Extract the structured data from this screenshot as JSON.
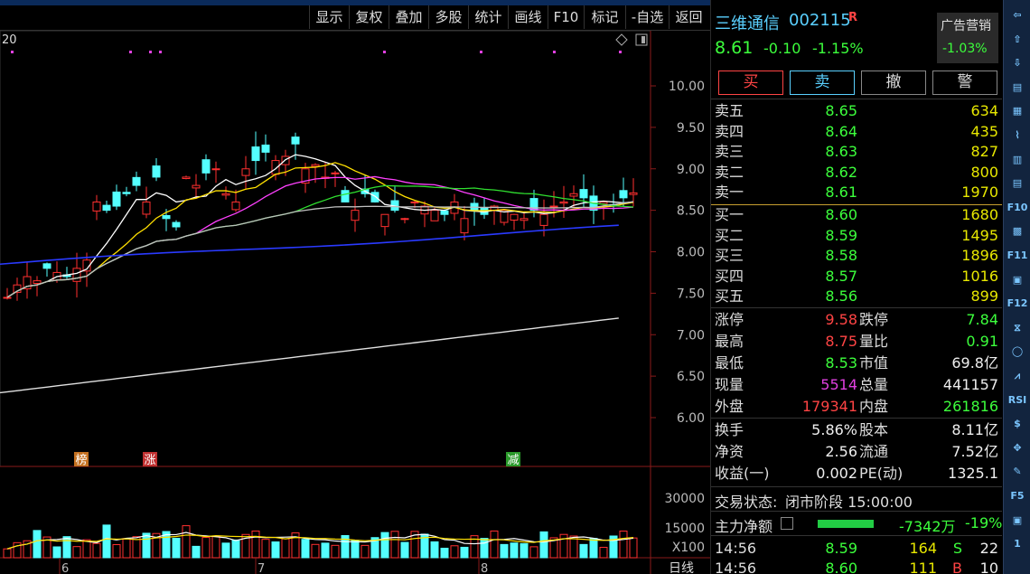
{
  "toolbar": {
    "items": [
      "显示",
      "复权",
      "叠加",
      "多股",
      "统计",
      "画线",
      "F10",
      "标记",
      "-自选",
      "返回"
    ]
  },
  "chart": {
    "corner_label": "20",
    "price_axis": [
      "10.00",
      "9.50",
      "9.00",
      "8.50",
      "8.00",
      "7.50",
      "7.00",
      "6.50",
      "6.00"
    ],
    "volume_axis": [
      "30000",
      "15000",
      "X100"
    ],
    "date_labels": [
      "6",
      "7",
      "8"
    ],
    "period_label": "日线",
    "badges": [
      {
        "text": "榜",
        "color": "#c47020"
      },
      {
        "text": "涨",
        "color": "#c03030"
      },
      {
        "text": "减",
        "color": "#2a9a2a"
      }
    ]
  },
  "quote": {
    "name": "三维通信",
    "code": "002115",
    "tag": "R",
    "price": "8.61",
    "change": "-0.10",
    "change_pct": "-1.15%",
    "ad_label": "广告营销",
    "ad_pct": "-1.03%",
    "buttons": [
      "买",
      "卖",
      "撤",
      "警"
    ],
    "asks": [
      {
        "label": "卖五",
        "price": "8.65",
        "vol": "634"
      },
      {
        "label": "卖四",
        "price": "8.64",
        "vol": "435"
      },
      {
        "label": "卖三",
        "price": "8.63",
        "vol": "827"
      },
      {
        "label": "卖二",
        "price": "8.62",
        "vol": "800"
      },
      {
        "label": "卖一",
        "price": "8.61",
        "vol": "1970"
      }
    ],
    "bids": [
      {
        "label": "买一",
        "price": "8.60",
        "vol": "1680"
      },
      {
        "label": "买二",
        "price": "8.59",
        "vol": "1495"
      },
      {
        "label": "买三",
        "price": "8.58",
        "vol": "1896"
      },
      {
        "label": "买四",
        "price": "8.57",
        "vol": "1016"
      },
      {
        "label": "买五",
        "price": "8.56",
        "vol": "899"
      }
    ],
    "stats": [
      {
        "l1": "涨停",
        "v1": "9.58",
        "c1": "red",
        "l2": "跌停",
        "v2": "7.84",
        "c2": "grn"
      },
      {
        "l1": "最高",
        "v1": "8.75",
        "c1": "red",
        "l2": "量比",
        "v2": "0.91",
        "c2": "grn"
      },
      {
        "l1": "最低",
        "v1": "8.53",
        "c1": "grn",
        "l2": "市值",
        "v2": "69.8亿",
        "c2": "wht"
      },
      {
        "l1": "现量",
        "v1": "5514",
        "c1": "mag",
        "l2": "总量",
        "v2": "441157",
        "c2": "wht"
      },
      {
        "l1": "外盘",
        "v1": "179341",
        "c1": "red",
        "l2": "内盘",
        "v2": "261816",
        "c2": "grn"
      }
    ],
    "fund": [
      {
        "l1": "换手",
        "v1": "5.86%",
        "l2": "股本",
        "v2": "8.11亿"
      },
      {
        "l1": "净资",
        "v1": "2.56",
        "l2": "流通",
        "v2": "7.52亿"
      },
      {
        "l1": "收益(一)",
        "v1": "0.002",
        "l2": "PE(动)",
        "v2": "1325.1"
      }
    ],
    "status_label": "交易状态:",
    "status_value": "闭市阶段 15:00:00",
    "mainflow_label": "主力净额",
    "mainflow_value": "-7342万",
    "mainflow_pct": "-19%",
    "ticks": [
      {
        "time": "14:56",
        "price": "8.59",
        "vol": "164",
        "side": "S",
        "n": "22"
      },
      {
        "time": "14:56",
        "price": "8.60",
        "vol": "111",
        "side": "B",
        "n": "10"
      }
    ]
  },
  "tools": [
    "⇦",
    "⇧",
    "⇩",
    "▤",
    "▦",
    "⌇",
    "▥",
    "▤",
    "F10",
    "▩",
    "F11",
    "▣",
    "F12",
    "⧖",
    "◯",
    "⩘",
    "RSI",
    "$",
    "✥",
    "✎",
    "F5",
    "▣",
    "1"
  ]
}
